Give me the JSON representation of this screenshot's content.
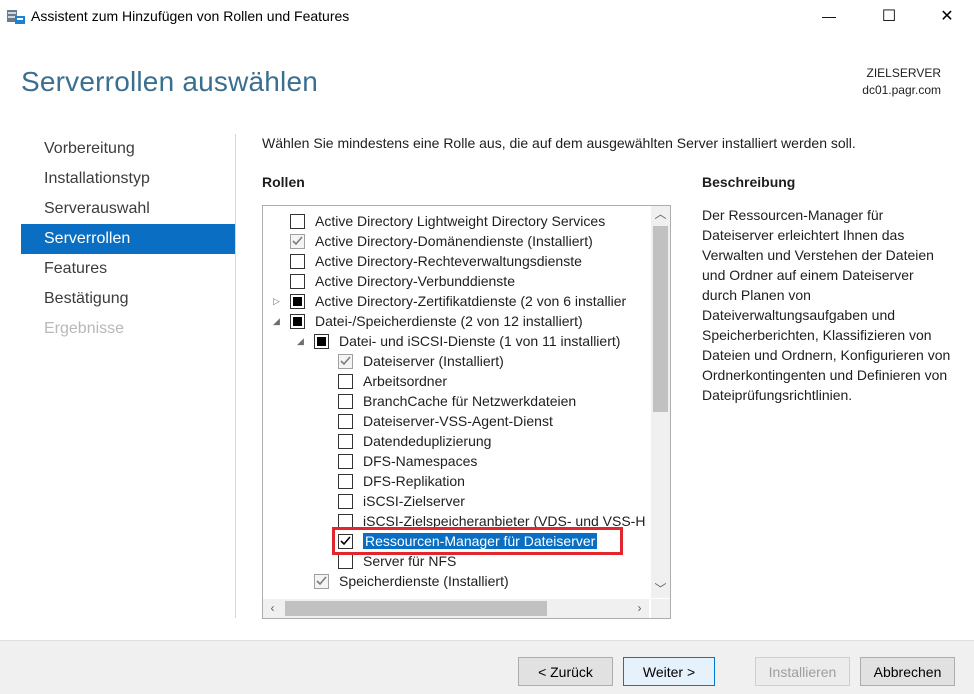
{
  "window": {
    "title": "Assistent zum Hinzufügen von Rollen und Features",
    "minimize_glyph": "—",
    "maximize_glyph": "☐",
    "close_glyph": "✕"
  },
  "header": {
    "title": "Serverrollen auswählen",
    "target_label": "ZIELSERVER",
    "target_value": "dc01.pagr.com"
  },
  "nav": {
    "items": [
      {
        "label": "Vorbereitung",
        "state": "normal"
      },
      {
        "label": "Installationstyp",
        "state": "normal"
      },
      {
        "label": "Serverauswahl",
        "state": "normal"
      },
      {
        "label": "Serverrollen",
        "state": "active"
      },
      {
        "label": "Features",
        "state": "normal"
      },
      {
        "label": "Bestätigung",
        "state": "normal"
      },
      {
        "label": "Ergebnisse",
        "state": "disabled"
      }
    ]
  },
  "main": {
    "instruction": "Wählen Sie mindestens eine Rolle aus, die auf dem ausgewählten Server installiert werden soll.",
    "roles_heading": "Rollen",
    "roles": [
      {
        "label": "Active Directory Lightweight Directory Services",
        "check": "unchecked",
        "level": 0,
        "expander": ""
      },
      {
        "label": "Active Directory-Domänendienste (Installiert)",
        "check": "checked-disabled",
        "level": 0,
        "expander": ""
      },
      {
        "label": "Active Directory-Rechteverwaltungsdienste",
        "check": "unchecked",
        "level": 0,
        "expander": ""
      },
      {
        "label": "Active Directory-Verbunddienste",
        "check": "unchecked",
        "level": 0,
        "expander": ""
      },
      {
        "label": "Active Directory-Zertifikatdienste (2 von 6 installier",
        "check": "partial",
        "level": 0,
        "expander": "collapsed"
      },
      {
        "label": "Datei-/Speicherdienste (2 von 12 installiert)",
        "check": "partial",
        "level": 0,
        "expander": "expanded"
      },
      {
        "label": "Datei- und iSCSI-Dienste (1 von 11 installiert)",
        "check": "partial",
        "level": 1,
        "expander": "expanded"
      },
      {
        "label": "Dateiserver (Installiert)",
        "check": "checked-disabled",
        "level": 2,
        "expander": ""
      },
      {
        "label": "Arbeitsordner",
        "check": "unchecked",
        "level": 2,
        "expander": ""
      },
      {
        "label": "BranchCache für Netzwerkdateien",
        "check": "unchecked",
        "level": 2,
        "expander": ""
      },
      {
        "label": "Dateiserver-VSS-Agent-Dienst",
        "check": "unchecked",
        "level": 2,
        "expander": ""
      },
      {
        "label": "Datendeduplizierung",
        "check": "unchecked",
        "level": 2,
        "expander": ""
      },
      {
        "label": "DFS-Namespaces",
        "check": "unchecked",
        "level": 2,
        "expander": ""
      },
      {
        "label": "DFS-Replikation",
        "check": "unchecked",
        "level": 2,
        "expander": ""
      },
      {
        "label": "iSCSI-Zielserver",
        "check": "unchecked",
        "level": 2,
        "expander": ""
      },
      {
        "label": "iSCSI-Zielspeicheranbieter (VDS- und VSS-H",
        "check": "unchecked",
        "level": 2,
        "expander": ""
      },
      {
        "label": "Ressourcen-Manager für Dateiserver",
        "check": "checked",
        "level": 2,
        "expander": "",
        "selected": true
      },
      {
        "label": "Server für NFS",
        "check": "unchecked",
        "level": 2,
        "expander": ""
      },
      {
        "label": "Speicherdienste (Installiert)",
        "check": "checked-disabled",
        "level": 1,
        "expander": ""
      }
    ]
  },
  "description": {
    "heading": "Beschreibung",
    "text": "Der Ressourcen-Manager für Dateiserver erleichtert Ihnen das Verwalten und Verstehen der Dateien und Ordner auf einem Dateiserver durch Planen von Dateiverwaltungsaufgaben und Speicherberichten, Klassifizieren von Dateien und Ordnern, Konfigurieren von Ordnerkontingenten und Definieren von Dateiprüfungsrichtlinien."
  },
  "footer": {
    "back_label": "< Zurück",
    "next_label": "Weiter >",
    "install_label": "Installieren",
    "cancel_label": "Abbrechen"
  },
  "colors": {
    "accent": "#0a6fc2",
    "header_title": "#3a6f8f",
    "highlight_box": "#e1262d"
  }
}
